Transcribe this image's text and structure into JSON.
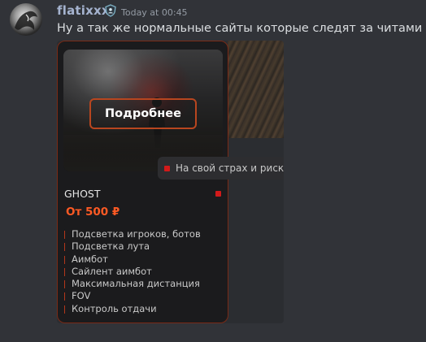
{
  "message": {
    "author": "flatixxx",
    "timestamp": "Today at 00:45",
    "text": "Ну а так же нормальные сайты которые следят за читами"
  },
  "embed": {
    "button_label": "Подробнее",
    "risk_label": "На свой страх и риск",
    "product_name": "GHOST",
    "price": "От 500 ₽",
    "features": [
      "Подсветка игроков, ботов",
      "Подсветка лута",
      "Аимбот",
      "Сайлент аимбот",
      "Максимальная дистанция",
      "FOV",
      "Контроль отдачи"
    ]
  },
  "colors": {
    "background": "#313338",
    "author": "#a5b3cf",
    "accent_orange": "#ff5a24",
    "status_red": "#d21a1a",
    "card_border": "#7a2a16"
  },
  "icons": {
    "role": "shield-person-icon",
    "status": "red-square-icon"
  }
}
